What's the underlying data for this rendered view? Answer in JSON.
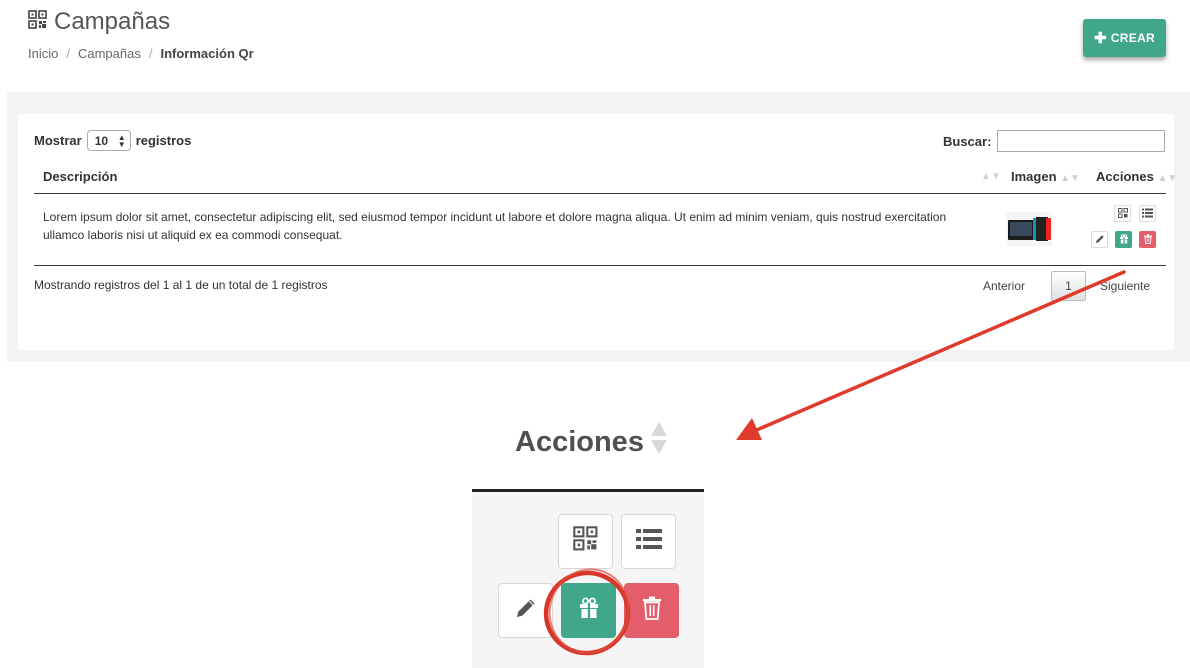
{
  "header": {
    "title": "Campañas",
    "title_icon": "qr-icon",
    "breadcrumb": [
      "Inicio",
      "Campañas",
      "Información Qr"
    ],
    "create_button": "CREAR",
    "create_icon": "plus-icon"
  },
  "controls": {
    "show_label": "Mostrar",
    "page_length": "10",
    "records_label": "registros",
    "search_label": "Buscar:",
    "search_value": ""
  },
  "table": {
    "columns": [
      "Descripción",
      "Imagen",
      "Acciones"
    ],
    "rows": [
      {
        "description": "Lorem ipsum dolor sit amet, consectetur adipiscing elit, sed eiusmod tempor incidunt ut labore et dolore magna aliqua. Ut enim ad minim veniam, quis nostrud exercitation ullamco laboris nisi ut aliquid ex ea commodi consequat.",
        "image": "nintendo-switch-thumbnail",
        "actions": [
          "qr-icon",
          "list-icon",
          "pencil-icon",
          "gift-icon",
          "trash-icon"
        ]
      }
    ]
  },
  "footer": {
    "info": "Mostrando registros del 1 al 1 de un total de 1 registros",
    "prev": "Anterior",
    "page": "1",
    "next": "Siguiente"
  },
  "zoom": {
    "header": "Acciones"
  },
  "colors": {
    "accent_green": "#40a78a",
    "danger_red": "#e35d6a",
    "annotation_red": "#e03a2a"
  }
}
